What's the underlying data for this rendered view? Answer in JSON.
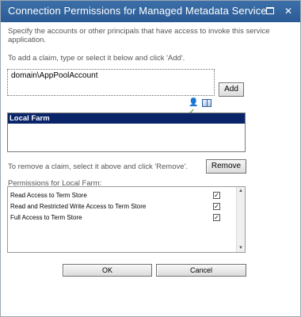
{
  "dialog": {
    "title": "Connection Permissions for Managed Metadata Service",
    "maximize_icon": "maximize-icon",
    "close_icon": "close-icon"
  },
  "description": "Specify the accounts or other principals that have access to invoke this service application.",
  "add_instruction": "To add a claim, type or select it below and click 'Add'.",
  "claim_input": {
    "value": "domain\\AppPoolAccount",
    "placeholder": ""
  },
  "add_button_label": "Add",
  "icons": {
    "check_names": "check-names-icon",
    "browse": "address-book-icon"
  },
  "claims": [
    {
      "label": "Local Farm",
      "selected": true
    }
  ],
  "remove_instruction": "To remove a claim, select it above and click 'Remove'.",
  "remove_button_label": "Remove",
  "permissions_label": "Permissions for Local Farm:",
  "permissions": [
    {
      "label": "Read Access to Term Store",
      "checked": true
    },
    {
      "label": "Read and Restricted Write Access to Term Store",
      "checked": true
    },
    {
      "label": "Full Access to Term Store",
      "checked": true
    }
  ],
  "ok_button_label": "OK",
  "cancel_button_label": "Cancel",
  "colors": {
    "titlebar": "#2b5b95",
    "selection": "#0a246a"
  }
}
